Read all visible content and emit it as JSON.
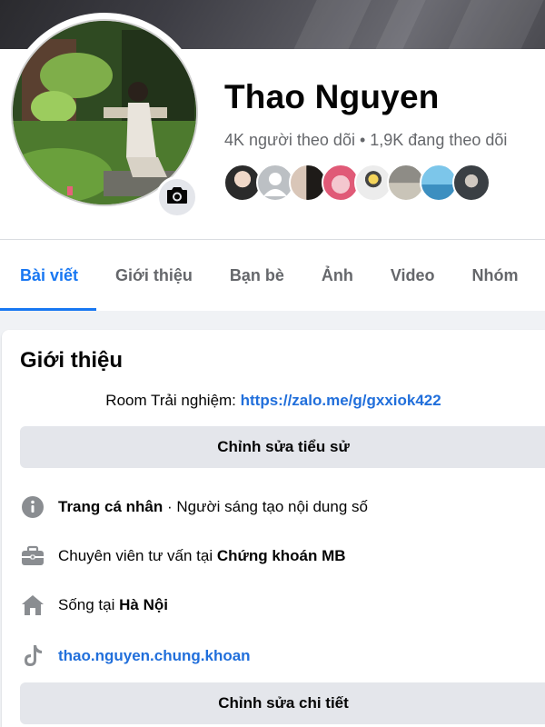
{
  "profile": {
    "name": "Thao Nguyen",
    "stats": "4K người theo dõi • 1,9K đang theo dõi"
  },
  "tabs": [
    "Bài viết",
    "Giới thiệu",
    "Bạn bè",
    "Ảnh",
    "Video",
    "Nhóm"
  ],
  "active_tab": "Bài viết",
  "intro": {
    "title": "Giới thiệu",
    "bio_prefix": "Room Trải nghiệm: ",
    "bio_link": "https://zalo.me/g/gxxiok422",
    "edit_bio_label": "Chỉnh sửa tiểu sử",
    "details": [
      {
        "icon": "info-icon",
        "bold": "Trang cá nhân",
        "rest": " · Người sáng tạo nội dung số"
      },
      {
        "icon": "briefcase-icon",
        "pre": "Chuyên viên tư vấn tại ",
        "bold": "Chứng khoán MB"
      },
      {
        "icon": "home-icon",
        "pre": "Sống tại ",
        "bold": "Hà Nội"
      },
      {
        "icon": "tiktok-icon",
        "link": "thao.nguyen.chung.khoan"
      }
    ],
    "edit_details_label": "Chỉnh sửa chi tiết"
  },
  "colors": {
    "accent": "#1877f2",
    "link": "#216fdb",
    "button_bg": "#e4e6eb",
    "secondary_text": "#65676b",
    "page_bg": "#f0f2f5"
  }
}
